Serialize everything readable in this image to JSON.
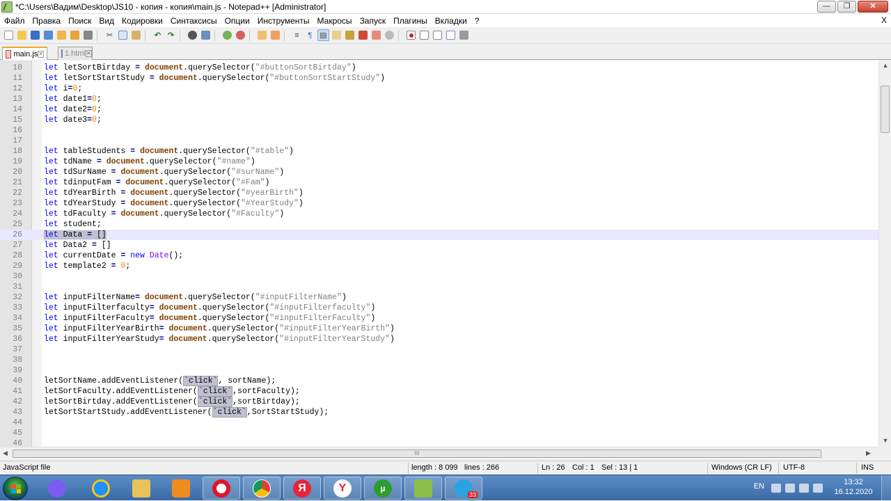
{
  "window": {
    "title": "*C:\\Users\\Вадим\\Desktop\\JS10 - копия - копия\\main.js - Notepad++ [Administrator]",
    "minimize_label": "—",
    "restore_label": "❐",
    "close_label": "✕"
  },
  "menu": {
    "items": [
      "Файл",
      "Правка",
      "Поиск",
      "Вид",
      "Кодировки",
      "Синтаксисы",
      "Опции",
      "Инструменты",
      "Макросы",
      "Запуск",
      "Плагины",
      "Вкладки",
      "?"
    ],
    "close_doc": "X"
  },
  "toolbar": {
    "icons": [
      "new-file-icon",
      "open-file-icon",
      "save-icon",
      "save-all-icon",
      "close-icon",
      "close-all-icon",
      "print-icon",
      "cut-icon",
      "copy-icon",
      "paste-icon",
      "undo-icon",
      "redo-icon",
      "find-icon",
      "replace-icon",
      "zoom-in-icon",
      "zoom-out-icon",
      "sync-vertical-icon",
      "sync-horizontal-icon",
      "word-wrap-icon",
      "show-all-chars-icon",
      "indent-guide-icon",
      "user-lang-icon",
      "doc-map-icon",
      "function-list-icon",
      "folder-workspace-icon",
      "monitoring-icon",
      "record-macro-icon",
      "stop-macro-icon",
      "play-macro-icon",
      "run-macro-multiple-icon",
      "save-macro-icon"
    ]
  },
  "tabs": [
    {
      "label": "main.js",
      "active": true
    },
    {
      "label": "1.html",
      "active": false
    }
  ],
  "editor": {
    "current_line": 26,
    "lines": [
      {
        "n": "10",
        "html": "<span class=\"kw\">let</span> letSortBirtday <span class=\"op\">=</span> <span class=\"obj\" style=\"color:#804000;font-weight:bold\">document</span>.querySelector(<span class=\"str\">\"#buttonSortBirtday\"</span>)"
      },
      {
        "n": "11",
        "html": "<span class=\"kw\">let</span> letSortStartStudy <span class=\"op\">=</span> <span class=\"obj\" style=\"color:#804000;font-weight:bold\">document</span>.querySelector(<span class=\"str\">\"#buttonSortStartStudy\"</span>)"
      },
      {
        "n": "12",
        "html": "<span class=\"kw\">let</span> i<span class=\"op\">=</span><span class=\"num\">0</span>;"
      },
      {
        "n": "13",
        "html": "<span class=\"kw\">let</span> date1<span class=\"op\">=</span><span class=\"num\">0</span>;"
      },
      {
        "n": "14",
        "html": "<span class=\"kw\">let</span> date2<span class=\"op\">=</span><span class=\"num\">0</span>;"
      },
      {
        "n": "15",
        "html": "<span class=\"kw\">let</span> date3<span class=\"op\">=</span><span class=\"num\">0</span>;"
      },
      {
        "n": "16",
        "html": ""
      },
      {
        "n": "17",
        "html": ""
      },
      {
        "n": "18",
        "html": "<span class=\"kw\">let</span> tableStudents <span class=\"op\">=</span> <span style=\"color:#804000;font-weight:bold\">document</span>.querySelector(<span class=\"str\">\"#table\"</span>)"
      },
      {
        "n": "19",
        "html": "<span class=\"kw\">let</span> tdName <span class=\"op\">=</span> <span style=\"color:#804000;font-weight:bold\">document</span>.querySelector(<span class=\"str\">\"#name\"</span>)"
      },
      {
        "n": "20",
        "html": "<span class=\"kw\">let</span> tdSurName <span class=\"op\">=</span> <span style=\"color:#804000;font-weight:bold\">document</span>.querySelector(<span class=\"str\">\"#surName\"</span>)"
      },
      {
        "n": "21",
        "html": "<span class=\"kw\">let</span> tdinputFam <span class=\"op\">=</span> <span style=\"color:#804000;font-weight:bold\">document</span>.querySelector(<span class=\"str\">\"#Fam\"</span>)"
      },
      {
        "n": "22",
        "html": "<span class=\"kw\">let</span> tdYearBirth <span class=\"op\">=</span> <span style=\"color:#804000;font-weight:bold\">document</span>.querySelector(<span class=\"str\">\"#yearBirth\"</span>)"
      },
      {
        "n": "23",
        "html": "<span class=\"kw\">let</span> tdYearStudy <span class=\"op\">=</span> <span style=\"color:#804000;font-weight:bold\">document</span>.querySelector(<span class=\"str\">\"#YearStudy\"</span>)"
      },
      {
        "n": "24",
        "html": "<span class=\"kw\">let</span> tdFaculty <span class=\"op\">=</span> <span style=\"color:#804000;font-weight:bold\">document</span>.querySelector(<span class=\"str\">\"#Faculty\"</span>)"
      },
      {
        "n": "25",
        "html": "<span class=\"kw\">let</span> student;"
      },
      {
        "n": "26",
        "html": "<span class=\"sel\"><span class=\"kw\">let</span> Data <span class=\"op\">=</span> []</span>"
      },
      {
        "n": "27",
        "html": "<span class=\"kw\">let</span> Data2 <span class=\"op\">=</span> []"
      },
      {
        "n": "28",
        "html": "<span class=\"kw\">let</span> currentDate <span class=\"op\">=</span> <span class=\"kw\">new</span> <span class=\"obj\">Date</span>();"
      },
      {
        "n": "29",
        "html": "<span class=\"kw\">let</span> template2 <span class=\"op\">=</span> <span class=\"num\">0</span>;"
      },
      {
        "n": "30",
        "html": ""
      },
      {
        "n": "31",
        "html": ""
      },
      {
        "n": "32",
        "html": "<span class=\"kw\">let</span> inputFilterName<span class=\"op\">=</span> <span style=\"color:#804000;font-weight:bold\">document</span>.querySelector(<span class=\"str\">\"#inputFilterName\"</span>)"
      },
      {
        "n": "33",
        "html": "<span class=\"kw\">let</span> inputFilterfaculty<span class=\"op\">=</span> <span style=\"color:#804000;font-weight:bold\">document</span>.querySelector(<span class=\"str\">\"#inputFilterfaculty\"</span>)"
      },
      {
        "n": "34",
        "html": "<span class=\"kw\">let</span> inputFilterFaculty<span class=\"op\">=</span> <span style=\"color:#804000;font-weight:bold\">document</span>.querySelector(<span class=\"str\">\"#inputFilterFaculty\"</span>)"
      },
      {
        "n": "35",
        "html": "<span class=\"kw\">let</span> inputFilterYearBirth<span class=\"op\">=</span> <span style=\"color:#804000;font-weight:bold\">document</span>.querySelector(<span class=\"str\">\"#inputFilterYearBirth\"</span>)"
      },
      {
        "n": "36",
        "html": "<span class=\"kw\">let</span> inputFilterYearStudy<span class=\"op\">=</span> <span style=\"color:#804000;font-weight:bold\">document</span>.querySelector(<span class=\"str\">\"#inputFilterYearStudy\"</span>)"
      },
      {
        "n": "37",
        "html": ""
      },
      {
        "n": "38",
        "html": ""
      },
      {
        "n": "39",
        "html": ""
      },
      {
        "n": "40",
        "html": "letSortName.addEventListener(<span class=\"hl\">`click`</span>, sortName);"
      },
      {
        "n": "41",
        "html": "letSortFaculty.addEventListener(<span class=\"hl\">`click`</span>,sortFaculty);"
      },
      {
        "n": "42",
        "html": "letSortBirtday.addEventListener(<span class=\"hl\">`click`</span>,sortBirtday);"
      },
      {
        "n": "43",
        "html": "letSortStartStudy.addEventListener(<span class=\"hl\">`click`</span>,SortStartStudy);"
      },
      {
        "n": "44",
        "html": ""
      },
      {
        "n": "45",
        "html": ""
      },
      {
        "n": "46",
        "html": ""
      }
    ]
  },
  "hscroll": {
    "grip": "III"
  },
  "status": {
    "file_type": "JavaScript file",
    "length": "length : 8 099",
    "lines": "lines : 266",
    "ln": "Ln : 26",
    "col": "Col : 1",
    "sel": "Sel : 13 | 1",
    "eol": "Windows (CR LF)",
    "encoding": "UTF-8",
    "mode": "INS"
  },
  "taskbar": {
    "apps": [
      {
        "name": "start-orb",
        "color": "#1f7d2f"
      },
      {
        "name": "alice-icon",
        "color": "#7b5cf0"
      },
      {
        "name": "internet-explorer-icon",
        "color": "#1e90ff"
      },
      {
        "name": "file-explorer-icon",
        "color": "#e8c25a"
      },
      {
        "name": "media-player-icon",
        "color": "#f08c1e"
      },
      {
        "name": "opera-icon",
        "color": "#e0142b"
      },
      {
        "name": "chrome-icon",
        "color": "#4caf50"
      },
      {
        "name": "yandex-icon",
        "color": "#e8233a"
      },
      {
        "name": "yandex-browser-icon",
        "color": "#ffffff"
      },
      {
        "name": "utorrent-icon",
        "color": "#2e9c2e"
      },
      {
        "name": "notepadpp-icon",
        "color": "#8bbf4c"
      },
      {
        "name": "telegram-icon",
        "color": "#2aa3e0"
      }
    ],
    "telegram_badge": "33",
    "lang": "EN",
    "time": "13:32",
    "date": "16.12.2020"
  }
}
